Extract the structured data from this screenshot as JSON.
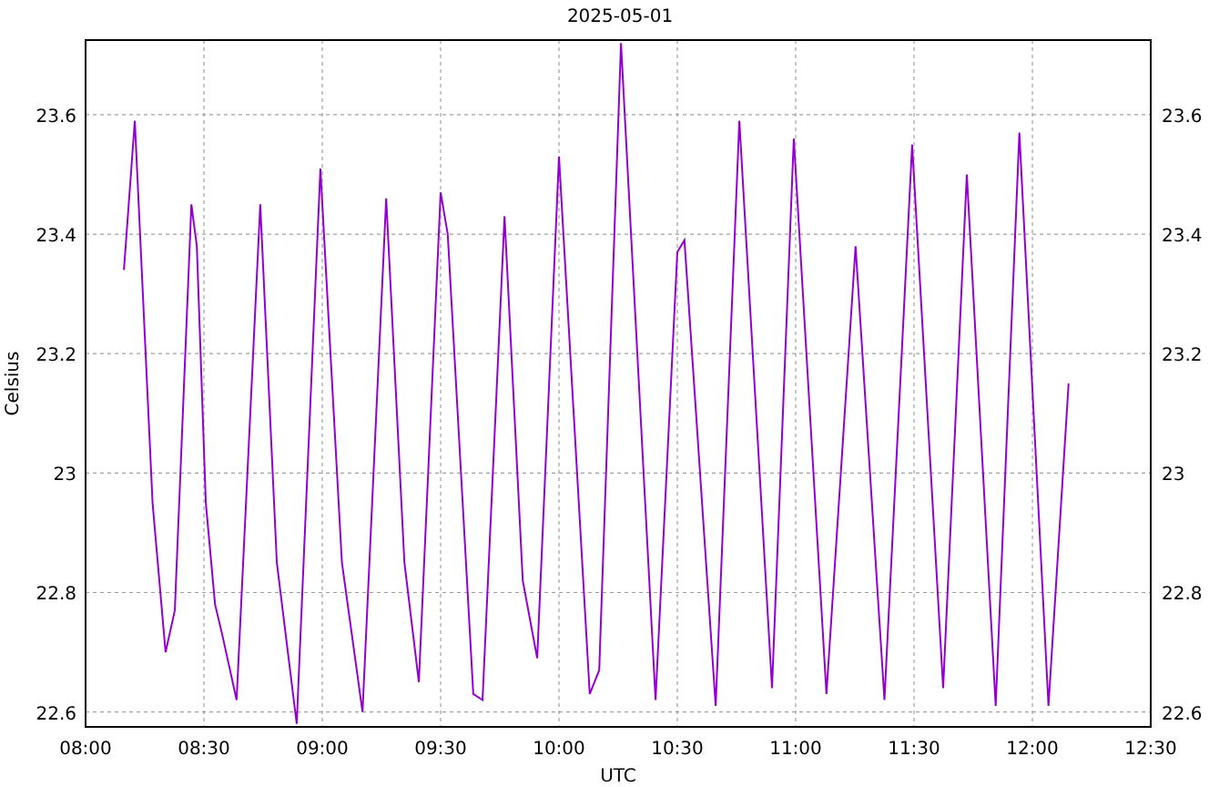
{
  "chart_data": {
    "type": "line",
    "title": "2025-05-01",
    "xlabel": "UTC",
    "ylabel": "Celsius",
    "xlim": [
      8,
      12.5
    ],
    "ylim": [
      22.575,
      23.725
    ],
    "y2lim": [
      22.575,
      23.725
    ],
    "grid": true,
    "xticks": [
      {
        "value": 8,
        "label": "08:00"
      },
      {
        "value": 8.5,
        "label": "08:30"
      },
      {
        "value": 9,
        "label": "09:00"
      },
      {
        "value": 9.5,
        "label": "09:30"
      },
      {
        "value": 10,
        "label": "10:00"
      },
      {
        "value": 10.5,
        "label": "10:30"
      },
      {
        "value": 11,
        "label": "11:00"
      },
      {
        "value": 11.5,
        "label": "11:30"
      },
      {
        "value": 12,
        "label": "12:00"
      },
      {
        "value": 12.5,
        "label": "12:30"
      }
    ],
    "yticks": [
      {
        "value": 22.6,
        "label": "22.6"
      },
      {
        "value": 22.8,
        "label": "22.8"
      },
      {
        "value": 23,
        "label": "23"
      },
      {
        "value": 23.2,
        "label": "23.2"
      },
      {
        "value": 23.4,
        "label": "23.4"
      },
      {
        "value": 23.6,
        "label": "23.6"
      }
    ],
    "y2ticks": [
      {
        "value": 22.6,
        "label": "22.6"
      },
      {
        "value": 22.8,
        "label": "22.8"
      },
      {
        "value": 23,
        "label": "23"
      },
      {
        "value": 23.2,
        "label": "23.2"
      },
      {
        "value": 23.4,
        "label": "23.4"
      },
      {
        "value": 23.6,
        "label": "23.6"
      }
    ],
    "x": [
      8.162,
      8.208,
      8.283,
      8.338,
      8.377,
      8.447,
      8.47,
      8.508,
      8.547,
      8.577,
      8.638,
      8.738,
      8.808,
      8.892,
      8.992,
      9.083,
      9.17,
      9.27,
      9.347,
      9.408,
      9.5,
      9.53,
      9.638,
      9.677,
      9.77,
      9.847,
      9.908,
      10,
      10.13,
      10.17,
      10.262,
      10.408,
      10.5,
      10.53,
      10.662,
      10.762,
      10.9,
      10.992,
      11.13,
      11.253,
      11.375,
      11.492,
      11.623,
      11.723,
      11.845,
      11.945,
      12.068,
      12.153
    ],
    "series": [
      {
        "color": "#9400d3",
        "values": [
          23.34,
          23.59,
          22.95,
          22.7,
          22.77,
          23.45,
          23.38,
          22.95,
          22.78,
          22.73,
          22.62,
          23.45,
          22.85,
          22.58,
          23.51,
          22.85,
          22.6,
          23.46,
          22.85,
          22.65,
          23.47,
          23.4,
          22.63,
          22.62,
          23.43,
          22.82,
          22.69,
          23.53,
          22.63,
          22.67,
          23.72,
          22.62,
          23.37,
          23.39,
          22.61,
          23.59,
          22.64,
          23.56,
          22.63,
          23.38,
          22.62,
          23.55,
          22.64,
          23.5,
          22.61,
          23.57,
          22.61,
          23.15
        ]
      }
    ]
  }
}
